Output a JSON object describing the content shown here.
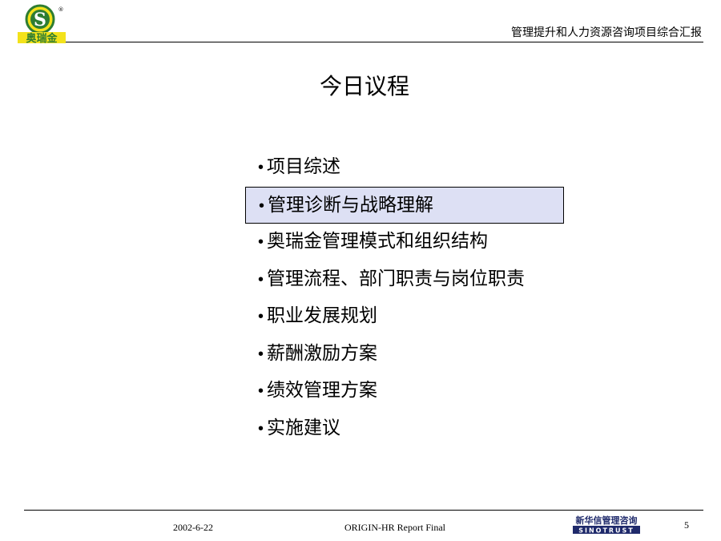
{
  "brand": {
    "logo_text": "奥瑞金",
    "logo_letter": "S",
    "registered_mark": "®",
    "green": "#2e7d32",
    "yellow": "#f3e21b"
  },
  "header": {
    "title": "管理提升和人力资源咨询项目综合汇报"
  },
  "slide": {
    "title": "今日议程",
    "bullet": "•",
    "highlight_color": "#dde0f4",
    "items": [
      {
        "label": "项目综述"
      },
      {
        "label": "管理诊断与战略理解",
        "current": true
      },
      {
        "label": "奥瑞金管理模式和组织结构"
      },
      {
        "label": "管理流程、部门职责与岗位职责"
      },
      {
        "label": "职业发展规划"
      },
      {
        "label": "薪酬激励方案"
      },
      {
        "label": "绩效管理方案"
      },
      {
        "label": "实施建议"
      }
    ]
  },
  "footer": {
    "date": "2002-6-22",
    "report": "ORIGIN-HR Report Final",
    "page": "5",
    "consultant_logo_cn": "新华信管理咨询",
    "consultant_logo_en": "SINOTRUST",
    "consultant_color": "#1f2a6b"
  }
}
